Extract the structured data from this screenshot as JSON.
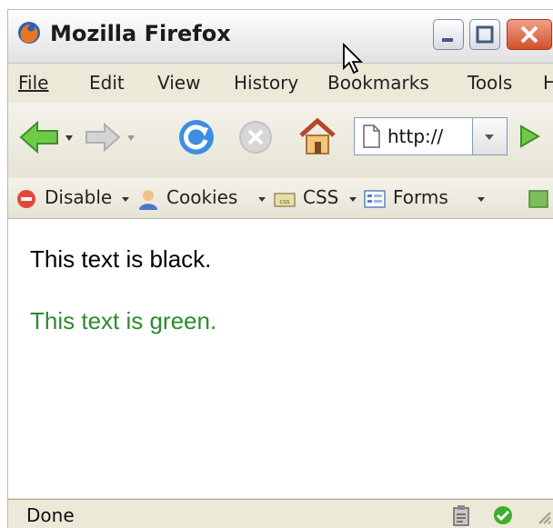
{
  "window": {
    "title": "Mozilla Firefox"
  },
  "menu": {
    "items": [
      {
        "label": "File"
      },
      {
        "label": "Edit"
      },
      {
        "label": "View"
      },
      {
        "label": "History"
      },
      {
        "label": "Bookmarks"
      },
      {
        "label": "Tools"
      },
      {
        "label": "Help"
      }
    ]
  },
  "navigation": {
    "url": "http://",
    "icons": [
      "back-arrow-icon",
      "forward-arrow-icon",
      "reload-icon",
      "stop-icon",
      "home-icon",
      "page-icon",
      "go-arrow-icon"
    ]
  },
  "devtoolbar": {
    "items": [
      {
        "label": "Disable",
        "icon": "disable-icon"
      },
      {
        "label": "Cookies",
        "icon": "cookies-icon"
      },
      {
        "label": "CSS",
        "icon": "css-icon"
      },
      {
        "label": "Forms",
        "icon": "forms-icon"
      }
    ]
  },
  "content": {
    "paragraphs": [
      {
        "text": "This text is black.",
        "color": "#000000"
      },
      {
        "text": "This text is green.",
        "color": "#2e8b2e"
      }
    ]
  },
  "status": {
    "text": "Done"
  },
  "colors": {
    "accent_green": "#2e8b2e",
    "close_red": "#d0502a"
  }
}
